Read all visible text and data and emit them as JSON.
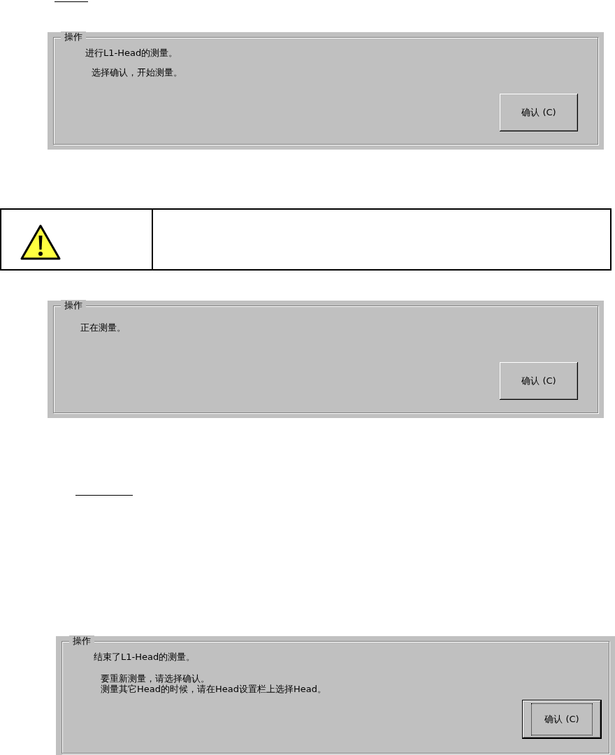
{
  "dialogs": [
    {
      "group_title": "操作",
      "paragraphs": [
        [
          "进行L1-Head的测量。"
        ],
        [
          "选择确认，开始测量。"
        ]
      ],
      "button": {
        "label": "确认 (C)",
        "focused": false
      }
    },
    {
      "group_title": "操作",
      "paragraphs": [
        [
          "正在测量。"
        ]
      ],
      "button": {
        "label": "确认 (C)",
        "focused": false
      }
    },
    {
      "group_title": "操作",
      "paragraphs": [
        [
          "结束了L1-Head的测量。"
        ],
        [
          "要重新测量，请选择确认。",
          "测量其它Head的时候，请在Head设置栏上选择Head。"
        ]
      ],
      "button": {
        "label": "确认 (C)",
        "focused": true
      }
    }
  ]
}
